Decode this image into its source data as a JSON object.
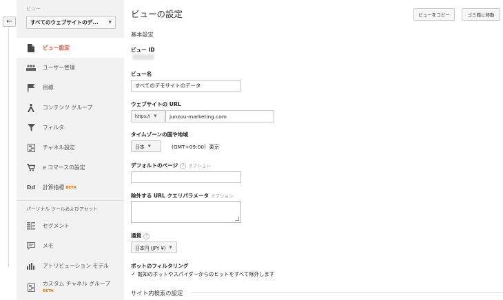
{
  "sidebar": {
    "view_caption": "ビュー",
    "view_selector": "すべてのウェブサイトのデ...",
    "items": [
      {
        "label": "ビュー設定",
        "icon": "document-icon",
        "active": true
      },
      {
        "label": "ユーザー管理",
        "icon": "users-icon"
      },
      {
        "label": "目標",
        "icon": "flag-icon"
      },
      {
        "label": "コンテンツ グループ",
        "icon": "person-walk-icon"
      },
      {
        "label": "フィルタ",
        "icon": "filter-icon"
      },
      {
        "label": "チャネル設定",
        "icon": "channel-icon"
      },
      {
        "label": "e コマースの設定",
        "icon": "cart-icon"
      },
      {
        "label": "計算指標",
        "icon": "dd-icon",
        "badge": "BETA"
      }
    ],
    "personal_section": "パーソナル ツールおよびアセット",
    "personal_items": [
      {
        "label": "セグメント",
        "icon": "segment-icon"
      },
      {
        "label": "メモ",
        "icon": "memo-icon"
      },
      {
        "label": "アトリビューション モデル",
        "icon": "bar-chart-icon"
      },
      {
        "label": "カスタム チャネル グループ",
        "icon": "channel-icon",
        "badge": "BETA"
      }
    ]
  },
  "main": {
    "title": "ビューの設定",
    "copy_button": "ビューをコピー",
    "trash_button": "ゴミ箱に移動",
    "section_basic": "基本設定",
    "view_id_label": "ビュー ID",
    "view_name_label": "ビュー名",
    "view_name_value": "すべてのデモサイトのデータ",
    "url_label": "ウェブサイトの URL",
    "protocol": "https://",
    "url_value": "junzou-marketing.com",
    "timezone_label": "タイムゾーンの国や地域",
    "country": "日本",
    "timezone": "(GMT+09:00）東京",
    "default_page_label": "デフォルトのページ",
    "optional": "オプション",
    "exclude_label": "除外する URL クエリパラメータ",
    "currency_label": "通貨",
    "currency_value": "日本円 (JPY ¥)",
    "bot_label": "ボットのフィルタリング",
    "bot_checkbox": "既知のボットやスパイダーからのヒットをすべて除外します",
    "site_search_label": "サイト内検索の設定",
    "help_glyph": "?"
  }
}
